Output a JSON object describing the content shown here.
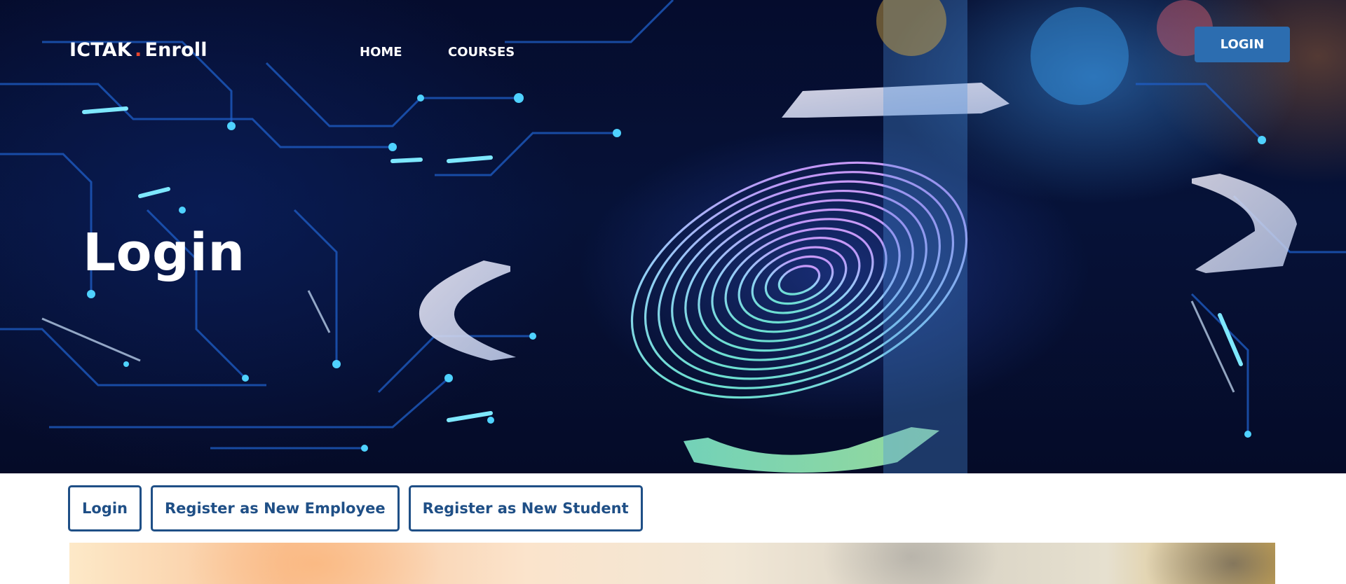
{
  "brand": {
    "name_part1": "ICTAK",
    "separator": ".",
    "name_part2": "Enroll"
  },
  "nav": {
    "items": [
      {
        "label": "HOME"
      },
      {
        "label": "COURSES"
      }
    ],
    "login_button": "LOGIN"
  },
  "hero": {
    "title": "Login",
    "image": "fingerprint-circuit-illustration"
  },
  "tabs": [
    {
      "label": "Login"
    },
    {
      "label": "Register as New Employee"
    },
    {
      "label": "Register as New Student"
    }
  ],
  "colors": {
    "brand_dot": "#e8452c",
    "primary_button": "#2c6db0",
    "tab_border": "#1f4f86",
    "hero_bg": "#061238"
  }
}
